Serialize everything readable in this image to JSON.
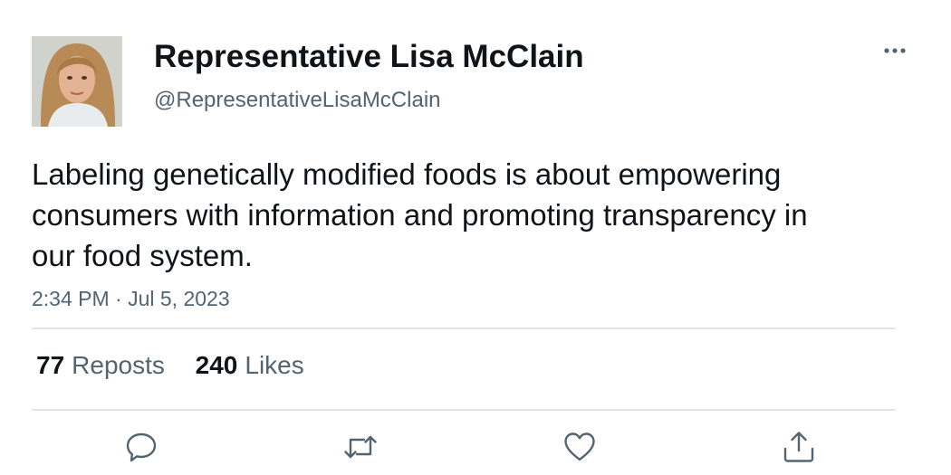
{
  "author": {
    "display_name": "Representative Lisa McClain",
    "handle": "@RepresentativeLisaMcClain"
  },
  "tweet": {
    "text": "Labeling genetically modified foods is about empowering consumers with information and promoting transparency in our food system.",
    "timestamp": "2:34 PM · Jul 5, 2023"
  },
  "stats": {
    "reposts_count": "77",
    "reposts_label": "Reposts",
    "likes_count": "240",
    "likes_label": "Likes"
  },
  "icons": {
    "more": "more-dots-icon",
    "reply": "reply-icon",
    "repost": "repost-icon",
    "like": "heart-icon",
    "share": "share-icon"
  },
  "colors": {
    "text_primary": "#0f1419",
    "text_secondary": "#536471",
    "divider": "#e1e4e8",
    "icon": "#536471"
  }
}
